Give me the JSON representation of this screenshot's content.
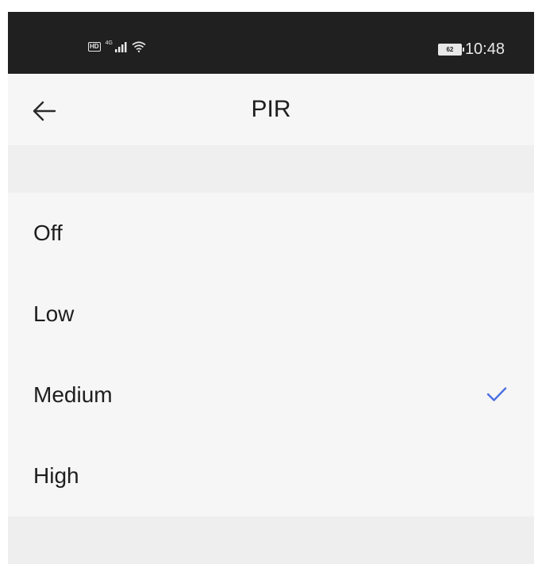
{
  "status_bar": {
    "hd_label": "HD",
    "network_label": "4G",
    "battery_level": "62",
    "time": "10:48"
  },
  "header": {
    "title": "PIR"
  },
  "options": [
    {
      "label": "Off",
      "selected": false
    },
    {
      "label": "Low",
      "selected": false
    },
    {
      "label": "Medium",
      "selected": true
    },
    {
      "label": "High",
      "selected": false
    }
  ],
  "colors": {
    "accent": "#4a6fe3",
    "status_bar_bg": "#202020",
    "background": "#f5f5f5"
  },
  "icons": {
    "back": "arrow-left-icon",
    "check": "check-icon",
    "signal": "signal-icon",
    "wifi": "wifi-icon",
    "battery": "battery-icon"
  }
}
